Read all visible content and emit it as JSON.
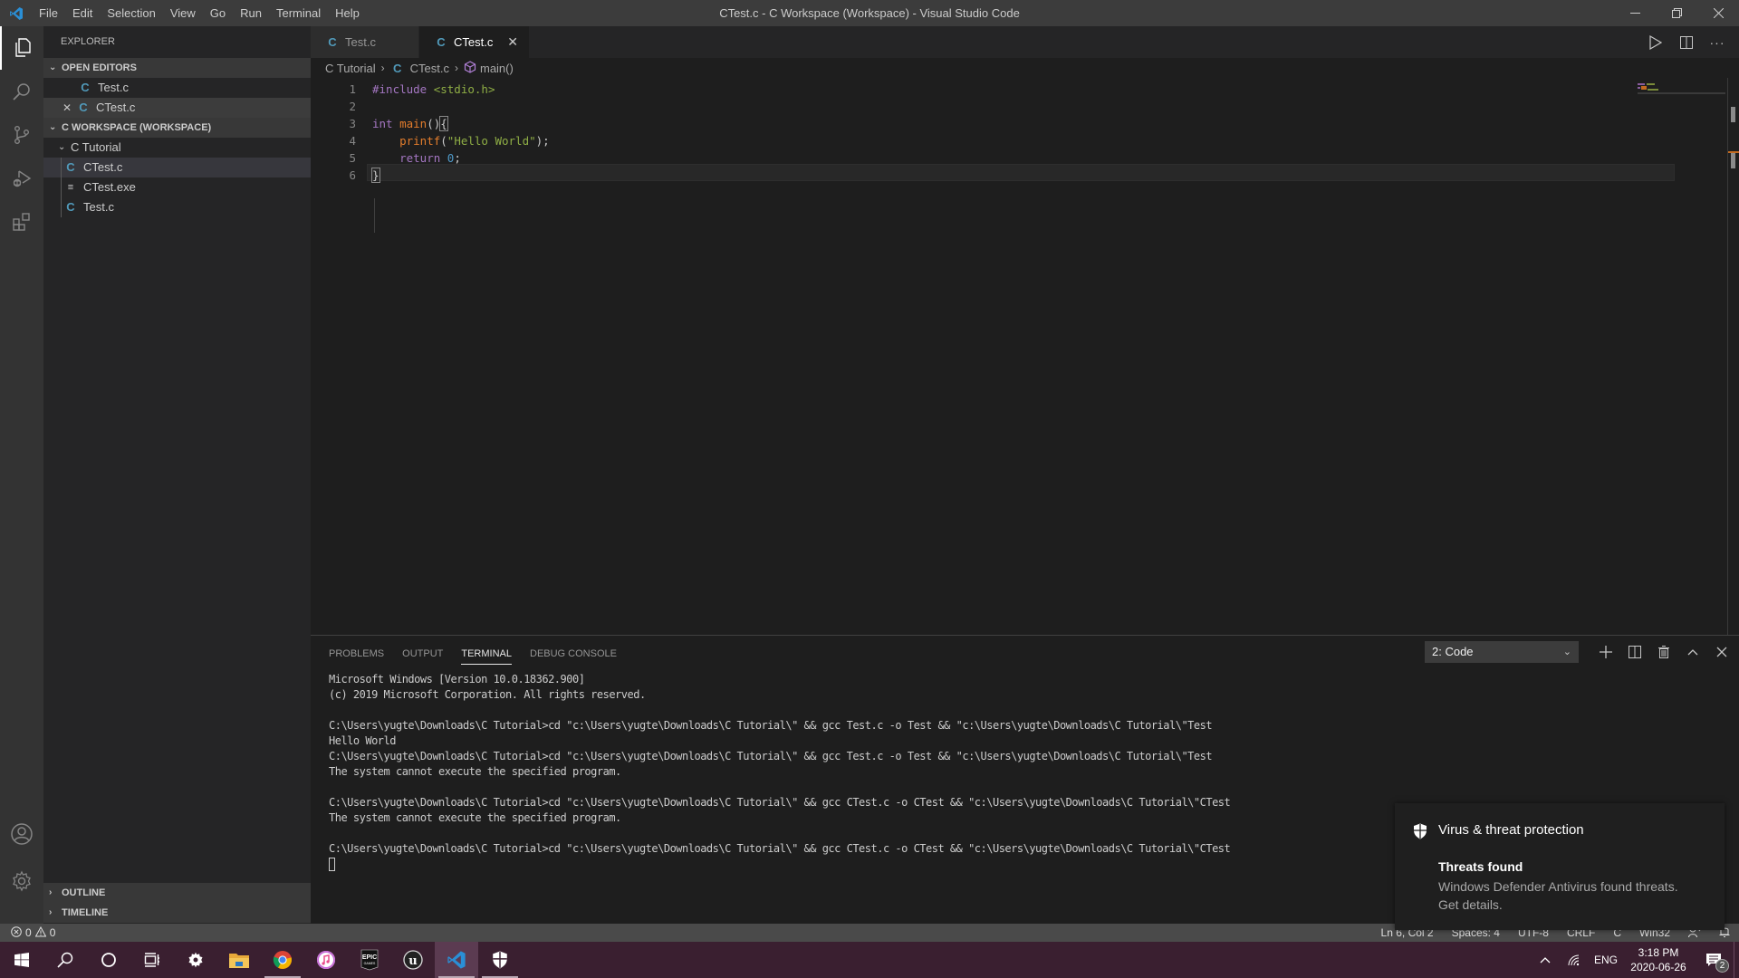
{
  "window": {
    "title": "CTest.c - C Workspace (Workspace) - Visual Studio Code",
    "menu": [
      "File",
      "Edit",
      "Selection",
      "View",
      "Go",
      "Run",
      "Terminal",
      "Help"
    ]
  },
  "activity_bar": {
    "items": [
      "explorer-icon",
      "search-icon",
      "source-control-icon",
      "run-debug-icon",
      "extensions-icon"
    ],
    "bottom": [
      "accounts-icon",
      "manage-gear-icon"
    ]
  },
  "sidebar": {
    "header": "EXPLORER",
    "open_editors": {
      "label": "OPEN EDITORS",
      "items": [
        {
          "icon": "C",
          "name": "Test.c"
        },
        {
          "icon": "C",
          "name": "CTest.c"
        }
      ]
    },
    "workspace": {
      "label": "C WORKSPACE (WORKSPACE)",
      "folder": "C Tutorial",
      "files": [
        {
          "icon": "C",
          "name": "CTest.c"
        },
        {
          "icon": "≡",
          "name": "CTest.exe"
        },
        {
          "icon": "C",
          "name": "Test.c"
        }
      ]
    },
    "outline_label": "OUTLINE",
    "timeline_label": "TIMELINE"
  },
  "tabs": [
    {
      "icon": "C",
      "label": "Test.c"
    },
    {
      "icon": "C",
      "label": "CTest.c"
    }
  ],
  "breadcrumb": {
    "folder": "C Tutorial",
    "file_icon": "C",
    "file": "CTest.c",
    "symbol": "main()"
  },
  "code": {
    "lines": [
      {
        "n": "1",
        "tokens": [
          [
            "t-pre",
            "#include "
          ],
          [
            "t-inc",
            "<stdio.h>"
          ]
        ]
      },
      {
        "n": "2",
        "tokens": []
      },
      {
        "n": "3",
        "tokens": [
          [
            "t-type",
            "int "
          ],
          [
            "t-fn",
            "main"
          ],
          [
            "t-punc",
            "()"
          ],
          [
            "t-punc br",
            "{"
          ]
        ]
      },
      {
        "n": "4",
        "tokens": [
          [
            "t-punc",
            "    "
          ],
          [
            "t-fn",
            "printf"
          ],
          [
            "t-punc",
            "("
          ],
          [
            "t-str",
            "\"Hello World\""
          ],
          [
            "t-punc",
            ");"
          ]
        ]
      },
      {
        "n": "5",
        "tokens": [
          [
            "t-punc",
            "    "
          ],
          [
            "t-type",
            "return "
          ],
          [
            "t-num",
            "0"
          ],
          [
            "t-punc",
            ";"
          ]
        ]
      },
      {
        "n": "6",
        "tokens": [
          [
            "t-punc br",
            "}"
          ]
        ]
      }
    ]
  },
  "panel": {
    "tabs": [
      "PROBLEMS",
      "OUTPUT",
      "TERMINAL",
      "DEBUG CONSOLE"
    ],
    "active_tab": "TERMINAL",
    "terminal_select": "2: Code",
    "terminal_lines": [
      "Microsoft Windows [Version 10.0.18362.900]",
      "(c) 2019 Microsoft Corporation. All rights reserved.",
      "",
      "C:\\Users\\yugte\\Downloads\\C Tutorial>cd \"c:\\Users\\yugte\\Downloads\\C Tutorial\\\" && gcc Test.c -o Test && \"c:\\Users\\yugte\\Downloads\\C Tutorial\\\"Test",
      "Hello World",
      "C:\\Users\\yugte\\Downloads\\C Tutorial>cd \"c:\\Users\\yugte\\Downloads\\C Tutorial\\\" && gcc Test.c -o Test && \"c:\\Users\\yugte\\Downloads\\C Tutorial\\\"Test",
      "The system cannot execute the specified program.",
      "",
      "C:\\Users\\yugte\\Downloads\\C Tutorial>cd \"c:\\Users\\yugte\\Downloads\\C Tutorial\\\" && gcc CTest.c -o CTest && \"c:\\Users\\yugte\\Downloads\\C Tutorial\\\"CTest",
      "The system cannot execute the specified program.",
      "",
      "C:\\Users\\yugte\\Downloads\\C Tutorial>cd \"c:\\Users\\yugte\\Downloads\\C Tutorial\\\" && gcc CTest.c -o CTest && \"c:\\Users\\yugte\\Downloads\\C Tutorial\\\"CTest"
    ]
  },
  "statusbar": {
    "errors": "0",
    "warnings": "0",
    "position": "Ln 6, Col 2",
    "spaces": "Spaces: 4",
    "encoding": "UTF-8",
    "eol": "CRLF",
    "language": "C",
    "platform": "Win32"
  },
  "toast": {
    "title": "Virus & threat protection",
    "heading": "Threats found",
    "body": "Windows Defender Antivirus found threats. Get details."
  },
  "taskbar": {
    "apps": [
      "start-icon",
      "search-icon",
      "cortana-icon",
      "task-view-icon",
      "settings-icon",
      "file-explorer-icon",
      "chrome-icon",
      "itunes-icon",
      "epic-games-icon",
      "unreal-engine-icon",
      "vscode-icon",
      "windows-security-icon"
    ],
    "tray": {
      "language": "ENG",
      "time": "3:18 PM",
      "date": "2020-06-26",
      "notification_count": "2"
    }
  }
}
